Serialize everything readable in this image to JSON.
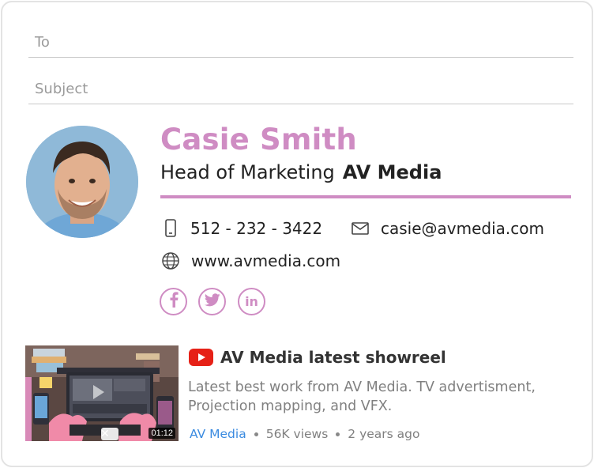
{
  "compose": {
    "to_placeholder": "To",
    "subject_placeholder": "Subject"
  },
  "signature": {
    "name": "Casie Smith",
    "title": "Head of Marketing",
    "company": "AV Media",
    "phone": "512 - 232 - 3422",
    "email": "casie@avmedia.com",
    "website": "www.avmedia.com",
    "accent_color": "#cf8cc3",
    "social": [
      "facebook-icon",
      "twitter-icon",
      "linkedin-icon"
    ]
  },
  "video": {
    "title": "AV Media latest showreel",
    "description": "Latest best work from AV Media. TV advertisment, Projection mapping, and VFX.",
    "channel": "AV Media",
    "views": "56K views",
    "age": "2 years ago",
    "duration": "01:12",
    "close_glyph": "✕",
    "in_glyph": "in",
    "channel_color": "#3b8be0",
    "youtube_color": "#e62117"
  }
}
